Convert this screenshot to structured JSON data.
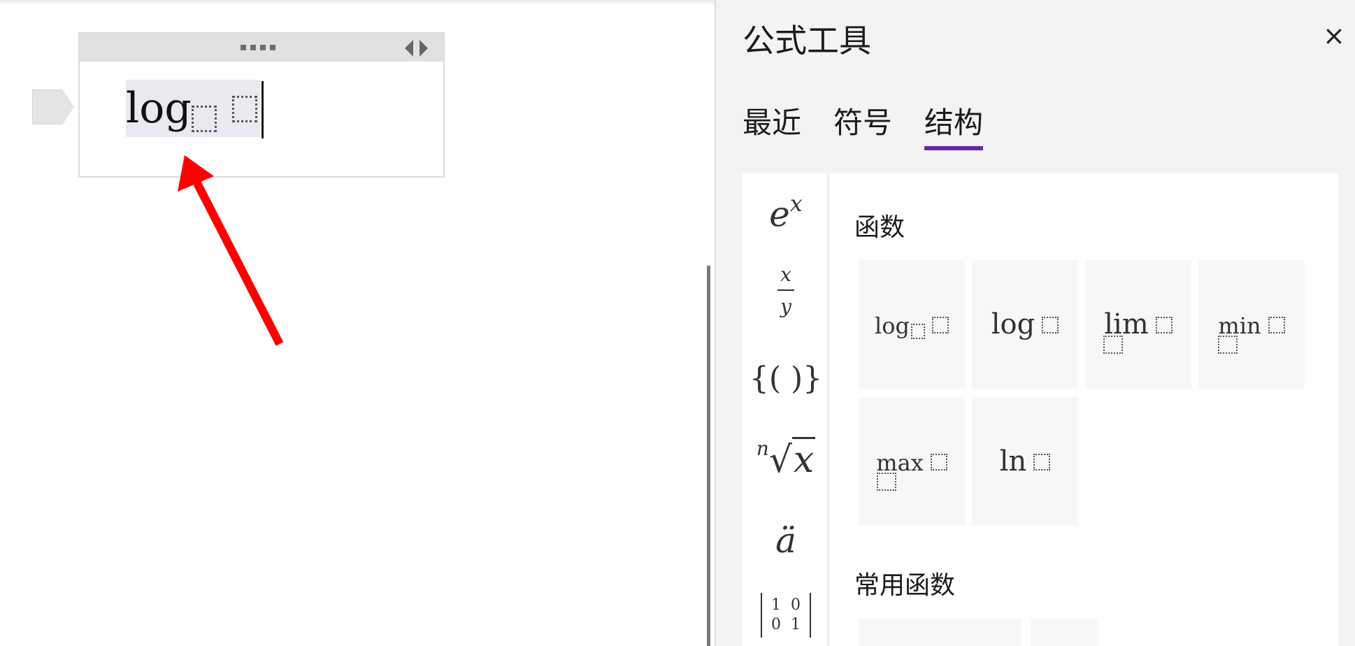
{
  "editor": {
    "equation": {
      "func": "log"
    }
  },
  "pane": {
    "title": "公式工具",
    "close_label": "×",
    "tabs": [
      {
        "label": "最近",
        "active": false
      },
      {
        "label": "符号",
        "active": false
      },
      {
        "label": "结构",
        "active": true
      }
    ],
    "categories": {
      "exp": {
        "base": "e",
        "exp": "x"
      },
      "fraction": {
        "num": "x",
        "den": "y"
      },
      "brackets": "{( )}",
      "radical": {
        "index": "n",
        "sign": "√",
        "arg": "x"
      },
      "accent": "ä",
      "matrix": {
        "r1c1": "1",
        "r1c2": "0",
        "r2c1": "0",
        "r2c2": "1"
      }
    },
    "sections": [
      {
        "heading": "函数",
        "items": [
          {
            "label": "log"
          },
          {
            "label": "log"
          },
          {
            "label": "lim"
          },
          {
            "label": "min"
          },
          {
            "label": "max"
          },
          {
            "label": "ln"
          }
        ]
      },
      {
        "heading": "常用函数"
      }
    ]
  },
  "colors": {
    "accent": "#6a27a6",
    "annotation_arrow": "#ff0000",
    "pane_bg": "#f3f3f3"
  }
}
